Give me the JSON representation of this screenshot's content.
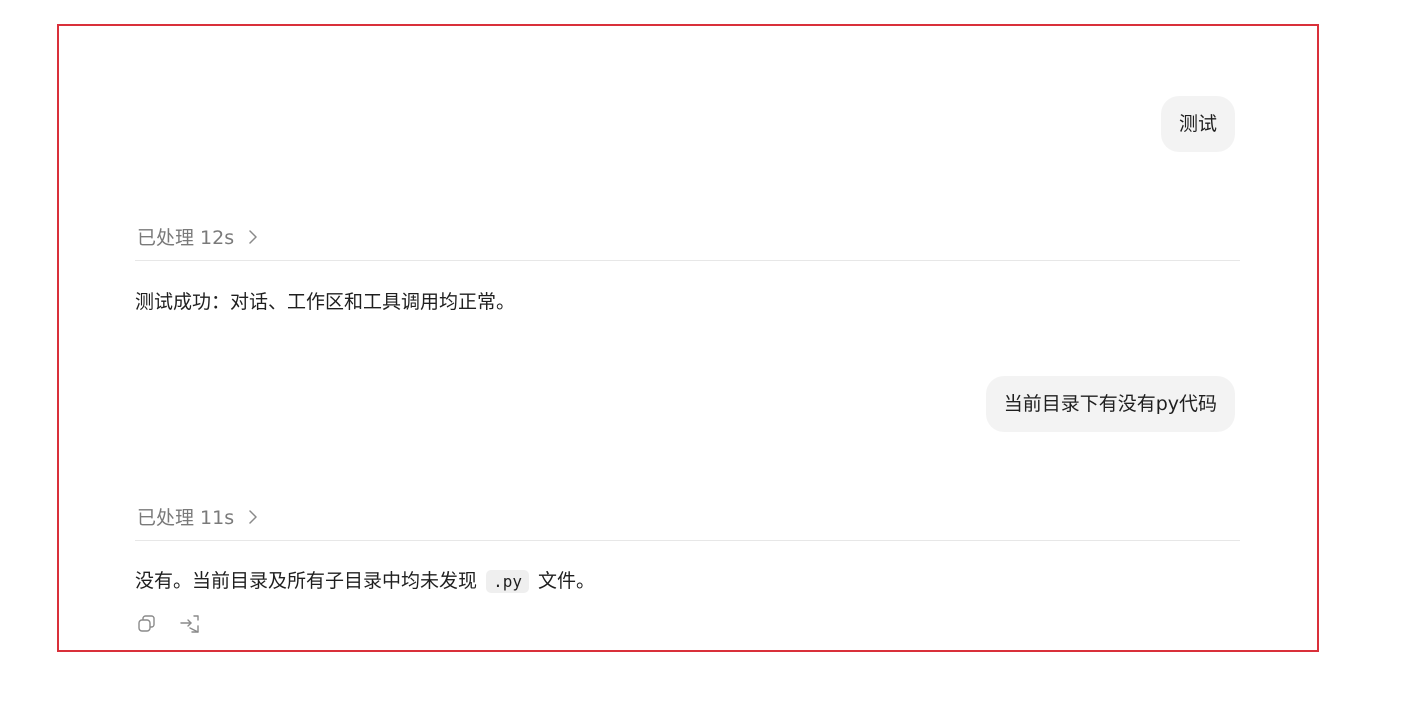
{
  "conversation": {
    "messages": [
      {
        "user_text": "测试",
        "processed_label": "已处理 12s",
        "answer_text": "测试成功：对话、工作区和工具调用均正常。"
      },
      {
        "user_text": "当前目录下有没有py代码",
        "processed_label": "已处理 11s",
        "answer_before": "没有。当前目录及所有子目录中均未发现",
        "answer_code": ".py",
        "answer_after": "文件。"
      }
    ]
  },
  "icons": {
    "processed_toggle": "chevron-right-icon",
    "copy": "copy-icon",
    "share": "share-icon"
  },
  "colors": {
    "frame_border": "#d9303a",
    "user_bubble_bg": "#f3f3f3",
    "muted_text": "#7a7a7a",
    "divider": "#e7e7e7"
  }
}
